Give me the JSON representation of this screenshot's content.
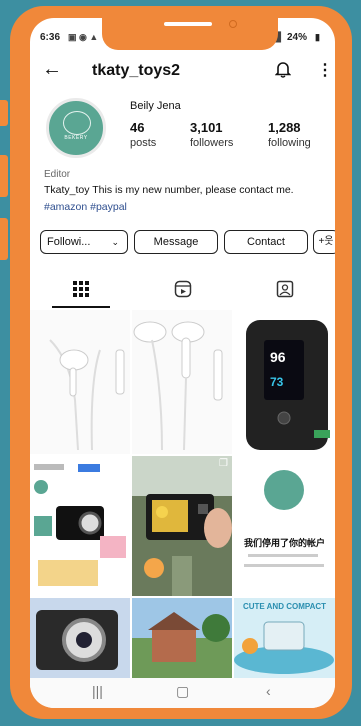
{
  "status_bar": {
    "time": "6:36",
    "battery": "24%"
  },
  "header": {
    "username": "tkaty_toys2"
  },
  "profile": {
    "display_name": "Beily Jena",
    "avatar_text": "BEKERY",
    "stats": [
      {
        "value": "46",
        "label": "posts"
      },
      {
        "value": "3,101",
        "label": "followers"
      },
      {
        "value": "1,288",
        "label": "following"
      }
    ],
    "category": "Editor",
    "bio": "Tkaty_toy This is my new number, please contact me.",
    "hashtags": "#amazon #paypal"
  },
  "actions": {
    "following": "Followi...",
    "message": "Message",
    "contact": "Contact"
  },
  "posts": {
    "avatar_post_text": "我们停用了你的帐户",
    "promo_text": "CUTE AND COMPACT"
  },
  "colors": {
    "frame": "#f0883a",
    "background": "#3d8fa1",
    "brand_green": "#5aa693",
    "hashtag": "#2f4f8f"
  }
}
